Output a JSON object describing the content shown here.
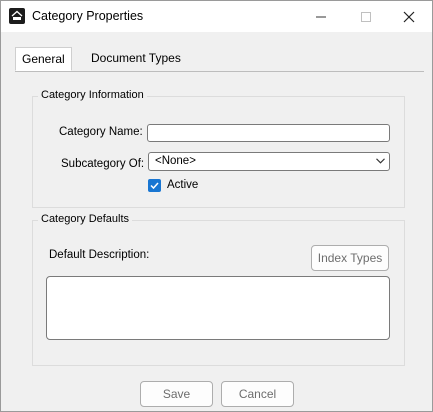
{
  "window": {
    "title": "Category Properties",
    "icon": "app-logo-icon",
    "controls": [
      "minimize-icon",
      "maximize-icon",
      "close-icon"
    ]
  },
  "tabs": [
    {
      "label": "General",
      "active": true
    },
    {
      "label": "Document Types",
      "active": false
    }
  ],
  "category_info": {
    "legend": "Category Information",
    "name_label": "Category Name:",
    "name_value": "",
    "subcategory_label": "Subcategory Of:",
    "subcategory_value": "<None>",
    "active_label": "Active",
    "active_checked": true
  },
  "category_defaults": {
    "legend": "Category Defaults",
    "description_label": "Default Description:",
    "index_types_button": "Index Types",
    "description_value": ""
  },
  "footer": {
    "save_label": "Save",
    "cancel_label": "Cancel"
  },
  "colors": {
    "checkbox_accent": "#1976d2",
    "dialog_background": "#f0f0f0"
  }
}
